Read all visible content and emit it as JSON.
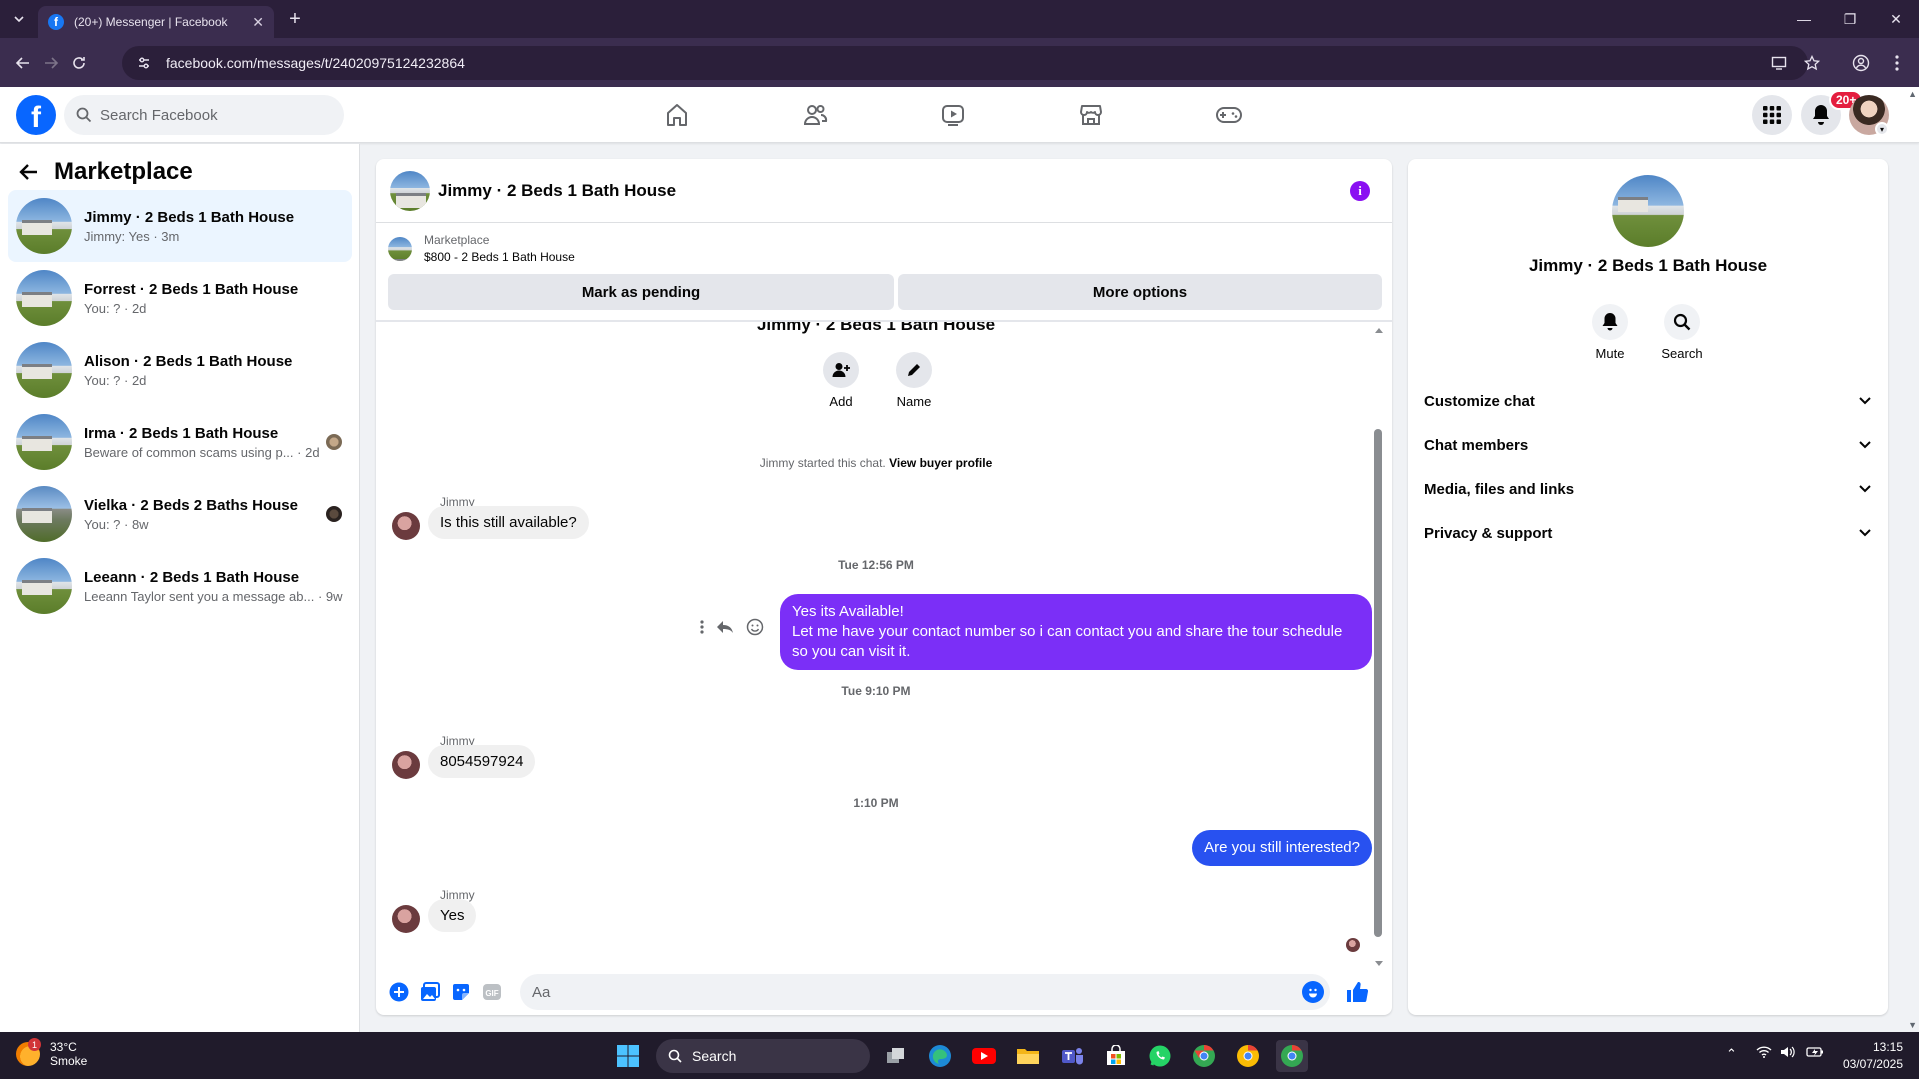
{
  "browser": {
    "tab_title": "(20+) Messenger | Facebook",
    "url": "facebook.com/messages/t/24020975124232864"
  },
  "fb": {
    "search_placeholder": "Search Facebook",
    "notification_count": "20+",
    "brand_color": "#0866ff"
  },
  "sidebar": {
    "title": "Marketplace",
    "conversations": [
      {
        "name": "Jimmy · 2 Beds 1 Bath House",
        "preview": "Jimmy: Yes · 3m",
        "active": true
      },
      {
        "name": "Forrest · 2 Beds 1 Bath House",
        "preview": "You: ? · 2d"
      },
      {
        "name": "Alison · 2 Beds 1 Bath House",
        "preview": "You: ? · 2d"
      },
      {
        "name": "Irma · 2 Beds 1 Bath House",
        "preview": "Beware of common scams using p...",
        "time": "· 2d"
      },
      {
        "name": "Vielka · 2 Beds 2 Baths House",
        "preview": "You: ? · 8w"
      },
      {
        "name": "Leeann · 2 Beds 1 Bath House",
        "preview": "Leeann Taylor sent you a message ab...",
        "time": "· 9w"
      }
    ]
  },
  "chat": {
    "title": "Jimmy · 2 Beds 1 Bath House",
    "listing_source": "Marketplace",
    "listing_title": "$800 - 2 Beds 1 Bath House",
    "mark_pending_label": "Mark as pending",
    "more_options_label": "More options",
    "header_repeat": "Jimmy · 2 Beds 1 Bath House",
    "add_label": "Add",
    "name_label": "Name",
    "started_text": "Jimmy started this chat.",
    "view_profile_label": "View buyer profile",
    "messages": [
      {
        "sender": "Jimmy",
        "text": "Is this still available?"
      },
      {
        "time": "Tue 12:56 PM"
      },
      {
        "text_line1": "Yes its Available!",
        "text_line2": "Let me have your contact number so i can contact you and share the tour schedule",
        "text_line3": "so you can visit it."
      },
      {
        "time": "Tue 9:10 PM"
      },
      {
        "sender": "Jimmy",
        "text": "8054597924"
      },
      {
        "time": "1:10 PM"
      },
      {
        "text": "Are you still interested?"
      },
      {
        "sender": "Jimmy",
        "text": "Yes"
      }
    ],
    "composer_placeholder": "Aa",
    "outgoing_color": "#7b2ff7"
  },
  "details": {
    "name": "Jimmy · 2 Beds 1 Bath House",
    "mute_label": "Mute",
    "search_label": "Search",
    "sections": [
      "Customize chat",
      "Chat members",
      "Media, files and links",
      "Privacy & support"
    ]
  },
  "taskbar": {
    "temperature": "33°C",
    "weather": "Smoke",
    "weather_badge": "1",
    "search_label": "Search",
    "time": "13:15",
    "date": "03/07/2025"
  }
}
